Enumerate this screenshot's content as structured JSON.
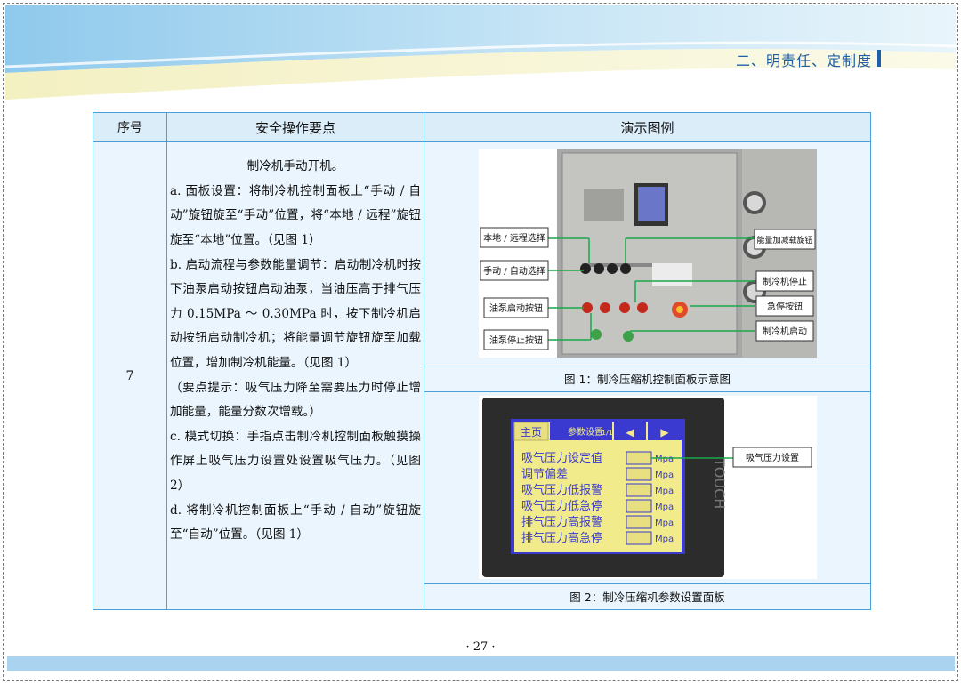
{
  "header": {
    "section_title": "二、明责任、定制度"
  },
  "table": {
    "col1": "序号",
    "col2": "安全操作要点",
    "col3": "演示图例",
    "row_no": "7",
    "lines": [
      "制冷机手动开机。",
      "a. 面板设置：将制冷机控制面板上“手动 / 自动”旋钮旋至“手动”位置，将“本地 / 远程”旋钮旋至“本地”位置。（见图 1）",
      "b. 启动流程与参数能量调节：启动制冷机时按下油泵启动按钮启动油泵，当油压高于排气压力 0.15MPa ～ 0.30MPa 时，按下制冷机启动按钮启动制冷机；将能量调节旋钮旋至加载位置，增加制冷机能量。（见图 1）",
      "（要点提示：吸气压力降至需要压力时停止增加能量，能量分数次增载。）",
      "c. 模式切换：手指点击制冷机控制面板触摸操作屏上吸气压力设置处设置吸气压力。（见图 2）",
      "d. 将制冷机控制面板上“手动 / 自动”旋钮旋至“自动”位置。（见图 1）"
    ],
    "fig1_caption": "图 1：制冷压缩机控制面板示意图",
    "fig2_caption": "图 2：制冷压缩机参数设置面板"
  },
  "fig1": {
    "left_labels": [
      "本地 / 远程选择",
      "手动 / 自动选择",
      "油泵启动按钮",
      "油泵停止按钮"
    ],
    "right_labels": [
      "能量加减载旋钮",
      "制冷机停止",
      "急停按钮",
      "制冷机启动"
    ]
  },
  "fig2": {
    "tab_main": "主页",
    "tab_params": "参数设置",
    "page": "1/1",
    "rows": [
      "吸气压力设定值",
      "调节偏差",
      "吸气压力低报警",
      "吸气压力低急停",
      "排气压力高报警",
      "排气压力高急停"
    ],
    "unit": "Mpa",
    "brand": "TOUCH",
    "callout": "吸气压力设置"
  },
  "footer": {
    "page_number": "· 27 ·"
  },
  "colors": {
    "accent": "#1e5fa8",
    "border": "#4a9fd8",
    "cell_bg": "#eaf5fd",
    "screen": "#f2eb8c",
    "screen_bg": "#3a3ad0"
  }
}
